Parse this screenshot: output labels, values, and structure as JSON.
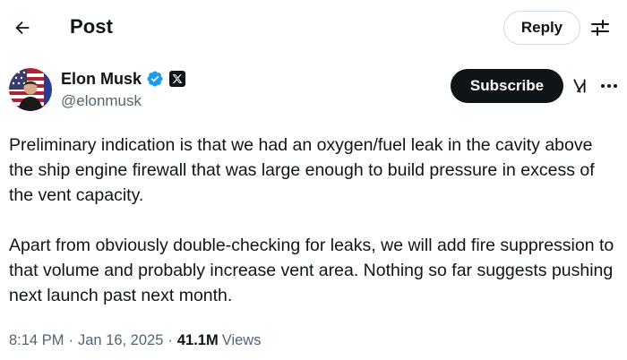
{
  "header": {
    "title": "Post",
    "reply_label": "Reply"
  },
  "author": {
    "display_name": "Elon Musk",
    "handle": "@elonmusk",
    "verified": true,
    "subscribe_label": "Subscribe"
  },
  "post": {
    "paragraphs": [
      "Preliminary indication is that we had an oxygen/fuel leak in the cavity above the ship engine firewall that was large enough to build pressure in excess of the vent capacity.",
      "Apart from obviously double-checking for leaks, we will add fire suppression to that volume and probably increase vent area. Nothing so far suggests pushing next launch past next month."
    ],
    "time": "8:14 PM",
    "date": "Jan 16, 2025",
    "views_count": "41.1M",
    "views_label": "Views"
  },
  "icons": {
    "back": "arrow-left-icon",
    "settings": "sliders-icon",
    "verified": "verified-checkmark-icon",
    "affiliation": "x-logo-icon",
    "grok": "grok-icon",
    "more": "more-horizontal-icon"
  },
  "colors": {
    "text_primary": "#0f1419",
    "text_secondary": "#536471",
    "verified_blue": "#1d9bf0",
    "border": "#cfd9de",
    "button_dark": "#0f1419"
  }
}
